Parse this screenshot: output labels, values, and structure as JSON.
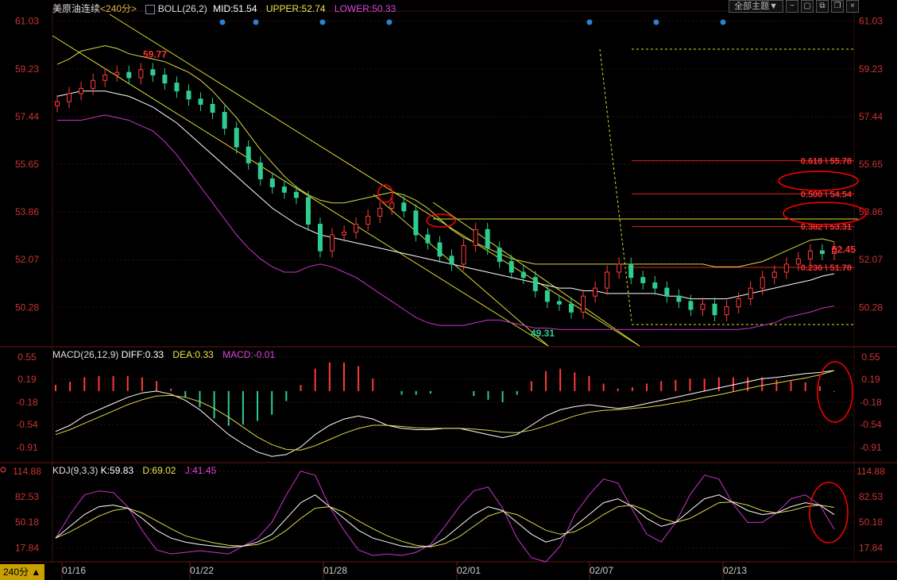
{
  "header": {
    "symbol": "美原油连续",
    "period": "<240分>",
    "indicator": "BOLL(26,2)",
    "mid": "MID:51.54",
    "upper": "UPPER:52.74",
    "lower": "LOWER:50.33"
  },
  "toolbar": {
    "theme_label": "全部主题",
    "theme_arrow": "▼",
    "btn_min": "−",
    "btn_a": "▢",
    "btn_b": "⧉",
    "btn_c": "❐",
    "btn_close": "×"
  },
  "macd_header": {
    "title": "MACD(26,12,9)",
    "diff": "DIFF:0.33",
    "dea": "DEA:0.33",
    "macd": "MACD:-0.01"
  },
  "kdj_header": {
    "title": "KDJ(9,3,3)",
    "k": "K:59.83",
    "d": "D:69.02",
    "j": "J:41.45"
  },
  "period_tab": "240分 ▲",
  "colors": {
    "up": "#ff3b3b",
    "down": "#2ecc8f",
    "upper": "#d8d84a",
    "mid": "#ffffff",
    "lower": "#cc33cc",
    "fib": "#dd2222",
    "ellipse": "#ff0000",
    "axis": "#cc3333",
    "grid": "#3a0f0f"
  },
  "chart_data": [
    {
      "type": "candlestick",
      "title": "美原油连续",
      "ylim": [
        48.8,
        61.4
      ],
      "y_ticks": [
        "61.03",
        "59.23",
        "57.44",
        "55.65",
        "53.86",
        "52.07",
        "50.28"
      ],
      "x_ticks": [
        "01/16",
        "01/22",
        "01/28",
        "02/01",
        "02/07",
        "02/13"
      ],
      "close": [
        58.0,
        58.3,
        58.5,
        58.8,
        59.0,
        59.1,
        58.9,
        59.2,
        59.0,
        58.7,
        58.4,
        58.1,
        57.9,
        57.6,
        57.0,
        56.3,
        55.7,
        55.1,
        54.8,
        54.6,
        54.4,
        53.4,
        52.4,
        53.0,
        53.1,
        53.4,
        53.7,
        54.0,
        54.2,
        53.9,
        53.0,
        52.7,
        52.2,
        51.9,
        52.6,
        53.2,
        52.5,
        52.0,
        51.6,
        51.4,
        50.9,
        50.5,
        50.4,
        50.1,
        50.7,
        51.0,
        51.6,
        51.9,
        51.4,
        51.2,
        51.0,
        50.7,
        50.5,
        50.2,
        50.4,
        50.0,
        50.3,
        50.6,
        51.0,
        51.4,
        51.6,
        51.9,
        52.1,
        52.4,
        52.3,
        52.5
      ],
      "annotations": [
        {
          "text": "59.77",
          "value": 59.77
        },
        {
          "text": "49.31",
          "value": 49.31
        },
        {
          "text": "52.45",
          "value": 52.45
        }
      ],
      "bollinger": {
        "upper": [
          59.4,
          59.6,
          59.9,
          60.0,
          60.1,
          60.0,
          59.8,
          59.7,
          59.6,
          59.5,
          59.3,
          59.1,
          58.8,
          58.4,
          57.9,
          57.4,
          56.8,
          56.2,
          55.7,
          55.2,
          54.8,
          54.5,
          54.3,
          54.2,
          54.2,
          54.3,
          54.4,
          54.5,
          54.6,
          54.5,
          54.3,
          54.0,
          53.6,
          53.2,
          52.9,
          52.7,
          52.5,
          52.3,
          52.1,
          52.0,
          51.9,
          51.9,
          51.9,
          51.9,
          51.9,
          51.9,
          51.9,
          51.9,
          51.9,
          51.9,
          51.9,
          51.9,
          51.9,
          51.9,
          51.9,
          51.8,
          51.8,
          51.8,
          51.9,
          52.0,
          52.2,
          52.4,
          52.6,
          52.8,
          52.85,
          52.74
        ],
        "mid": [
          58.2,
          58.3,
          58.4,
          58.4,
          58.4,
          58.3,
          58.2,
          58.0,
          57.8,
          57.5,
          57.2,
          56.8,
          56.4,
          56.0,
          55.6,
          55.2,
          54.8,
          54.4,
          54.0,
          53.7,
          53.4,
          53.2,
          53.0,
          52.9,
          52.8,
          52.7,
          52.6,
          52.5,
          52.4,
          52.3,
          52.2,
          52.1,
          52.0,
          51.9,
          51.8,
          51.7,
          51.6,
          51.5,
          51.4,
          51.3,
          51.2,
          51.1,
          51.0,
          51.0,
          50.9,
          50.9,
          50.8,
          50.8,
          50.8,
          50.8,
          50.8,
          50.7,
          50.7,
          50.6,
          50.6,
          50.6,
          50.6,
          50.7,
          50.8,
          50.9,
          51.0,
          51.1,
          51.2,
          51.3,
          51.45,
          51.54
        ],
        "lower": [
          57.3,
          57.3,
          57.3,
          57.4,
          57.5,
          57.4,
          57.3,
          57.1,
          56.9,
          56.5,
          56.0,
          55.4,
          54.8,
          54.2,
          53.6,
          53.0,
          52.5,
          52.1,
          51.8,
          51.6,
          51.6,
          51.8,
          51.9,
          51.8,
          51.6,
          51.4,
          51.1,
          50.8,
          50.5,
          50.2,
          49.9,
          49.7,
          49.6,
          49.6,
          49.6,
          49.7,
          49.8,
          49.8,
          49.7,
          49.6,
          49.5,
          49.5,
          49.45,
          49.45,
          49.45,
          49.45,
          49.45,
          49.45,
          49.45,
          49.45,
          49.45,
          49.45,
          49.45,
          49.45,
          49.45,
          49.45,
          49.45,
          49.45,
          49.5,
          49.6,
          49.7,
          49.9,
          50.0,
          50.1,
          50.25,
          50.33
        ]
      },
      "fibonacci": [
        {
          "label": "0.618 \\ 55.78",
          "value": 55.78
        },
        {
          "label": "0.500 \\ 54.54",
          "value": 54.54
        },
        {
          "label": "0.382 \\ 53.31",
          "value": 53.31
        },
        {
          "label": "0.236 \\ 51.78",
          "value": 51.78
        }
      ]
    },
    {
      "type": "macd",
      "title": "MACD(26,12,9)",
      "ylim": [
        -1.15,
        0.7
      ],
      "y_ticks": [
        "0.55",
        "0.19",
        "-0.18",
        "-0.54",
        "-0.91"
      ],
      "diff": [
        -0.65,
        -0.55,
        -0.4,
        -0.3,
        -0.2,
        -0.1,
        -0.03,
        0.0,
        -0.05,
        -0.15,
        -0.3,
        -0.5,
        -0.7,
        -0.85,
        -0.98,
        -1.05,
        -1.02,
        -0.9,
        -0.7,
        -0.55,
        -0.45,
        -0.4,
        -0.45,
        -0.55,
        -0.6,
        -0.62,
        -0.62,
        -0.6,
        -0.6,
        -0.65,
        -0.7,
        -0.75,
        -0.7,
        -0.55,
        -0.4,
        -0.3,
        -0.25,
        -0.22,
        -0.25,
        -0.28,
        -0.25,
        -0.2,
        -0.15,
        -0.1,
        -0.05,
        0.0,
        0.05,
        0.1,
        0.15,
        0.2,
        0.22,
        0.25,
        0.28,
        0.3,
        0.33
      ],
      "dea": [
        -0.7,
        -0.62,
        -0.52,
        -0.42,
        -0.32,
        -0.22,
        -0.14,
        -0.08,
        -0.07,
        -0.1,
        -0.17,
        -0.28,
        -0.42,
        -0.58,
        -0.74,
        -0.86,
        -0.94,
        -0.95,
        -0.88,
        -0.78,
        -0.68,
        -0.6,
        -0.55,
        -0.55,
        -0.57,
        -0.59,
        -0.6,
        -0.6,
        -0.6,
        -0.61,
        -0.63,
        -0.66,
        -0.67,
        -0.63,
        -0.56,
        -0.48,
        -0.4,
        -0.34,
        -0.31,
        -0.3,
        -0.28,
        -0.26,
        -0.23,
        -0.19,
        -0.15,
        -0.1,
        -0.06,
        -0.01,
        0.04,
        0.09,
        0.13,
        0.17,
        0.21,
        0.26,
        0.33
      ],
      "histogram": [
        0.1,
        0.15,
        0.22,
        0.24,
        0.24,
        0.24,
        0.22,
        0.16,
        0.04,
        -0.1,
        -0.26,
        -0.44,
        -0.56,
        -0.54,
        -0.48,
        -0.38,
        -0.16,
        0.1,
        0.36,
        0.46,
        0.46,
        0.4,
        0.2,
        0.0,
        -0.06,
        -0.06,
        -0.04,
        0.0,
        0.0,
        -0.08,
        -0.14,
        -0.18,
        -0.06,
        0.16,
        0.32,
        0.36,
        0.3,
        0.24,
        0.12,
        0.04,
        0.06,
        0.12,
        0.16,
        0.18,
        0.2,
        0.2,
        0.22,
        0.22,
        0.22,
        0.22,
        0.18,
        0.16,
        0.14,
        0.08,
        -0.01
      ]
    },
    {
      "type": "kdj",
      "title": "KDJ(9,3,3)",
      "ylim": [
        0,
        125
      ],
      "y_ticks": [
        "114.88",
        "82.53",
        "50.18",
        "17.84"
      ],
      "k": [
        30,
        45,
        60,
        70,
        72,
        68,
        55,
        40,
        30,
        25,
        22,
        20,
        18,
        20,
        25,
        35,
        55,
        75,
        85,
        70,
        55,
        40,
        30,
        25,
        20,
        18,
        20,
        30,
        45,
        60,
        70,
        65,
        50,
        35,
        25,
        30,
        45,
        60,
        75,
        80,
        70,
        55,
        45,
        50,
        65,
        80,
        85,
        75,
        65,
        60,
        62,
        70,
        75,
        72,
        59.83
      ],
      "d": [
        30,
        38,
        48,
        58,
        65,
        68,
        62,
        52,
        42,
        33,
        28,
        24,
        21,
        20,
        22,
        28,
        40,
        55,
        68,
        70,
        63,
        52,
        42,
        33,
        26,
        21,
        19,
        23,
        32,
        45,
        58,
        64,
        60,
        50,
        40,
        35,
        38,
        48,
        60,
        70,
        72,
        65,
        55,
        50,
        55,
        65,
        75,
        76,
        72,
        65,
        62,
        65,
        70,
        72,
        69.02
      ],
      "j": [
        30,
        60,
        85,
        90,
        88,
        70,
        40,
        15,
        10,
        12,
        14,
        12,
        10,
        20,
        30,
        50,
        85,
        115,
        110,
        70,
        40,
        15,
        8,
        10,
        8,
        12,
        22,
        45,
        70,
        90,
        95,
        68,
        30,
        5,
        0,
        20,
        60,
        85,
        105,
        100,
        66,
        35,
        25,
        50,
        85,
        110,
        105,
        73,
        50,
        50,
        62,
        80,
        85,
        72,
        41.45
      ]
    }
  ]
}
